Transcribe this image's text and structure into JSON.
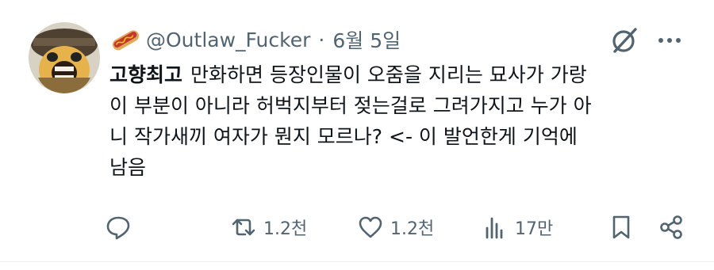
{
  "tweet": {
    "handle": "@Outlaw_Fucker",
    "separator": "·",
    "date": "6월 5일",
    "quoted_name": "고향최고",
    "text": "만화하면 등장인물이 오줌을 지리는 묘사가 가랑\n이 부분이 아니라 허벅지부터 젖는걸로 그려가지고 누가 아\n니 작가새끼 여자가 뭔지 모르나? <- 이 발언한게 기억에\n남음"
  },
  "actions": {
    "retweets": "1.2천",
    "likes": "1.2천",
    "views": "17만"
  },
  "icons": {
    "emoji": "hotdog-emoji",
    "grok": "grok-icon",
    "more": "more-icon",
    "reply": "reply-icon",
    "retweet": "retweet-icon",
    "like": "heart-icon",
    "views": "views-icon",
    "bookmark": "bookmark-icon",
    "share": "share-icon"
  },
  "colors": {
    "text": "#0f1419",
    "muted": "#536471",
    "divider": "#eff3f4"
  }
}
